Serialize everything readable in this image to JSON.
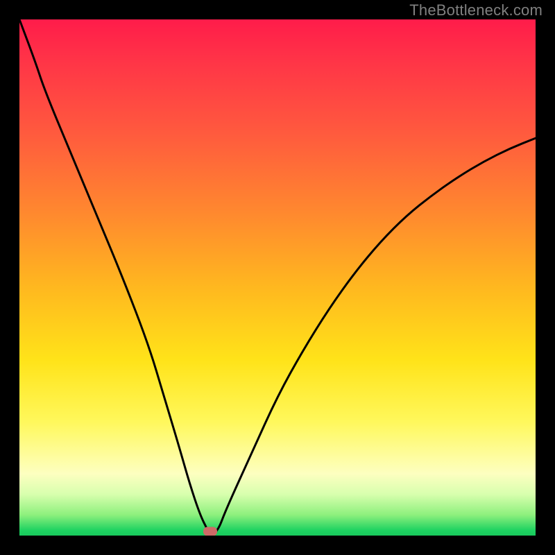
{
  "watermark": "TheBottleneck.com",
  "colors": {
    "frame": "#000000",
    "curve": "#000000",
    "marker": "#cd6a67",
    "watermark": "#808080"
  },
  "chart_data": {
    "type": "line",
    "title": "",
    "xlabel": "",
    "ylabel": "",
    "xlim": [
      0,
      100
    ],
    "ylim": [
      0,
      100
    ],
    "grid": false,
    "axes_visible": false,
    "series": [
      {
        "name": "bottleneck-curve",
        "x": [
          0,
          3,
          5,
          10,
          15,
          20,
          25,
          28,
          31,
          33,
          35,
          36.5,
          37,
          38.5,
          40,
          45,
          50,
          55,
          60,
          65,
          70,
          75,
          80,
          85,
          90,
          95,
          100
        ],
        "y": [
          100,
          92,
          86,
          74,
          62,
          50,
          37,
          27,
          17,
          10,
          4,
          1,
          0,
          1,
          5,
          16,
          27,
          36,
          44,
          51,
          57,
          62,
          66,
          69.5,
          72.5,
          75,
          77
        ]
      }
    ],
    "annotations": [
      {
        "name": "sweet-spot-marker",
        "x": 37,
        "y": 0.8
      }
    ]
  }
}
